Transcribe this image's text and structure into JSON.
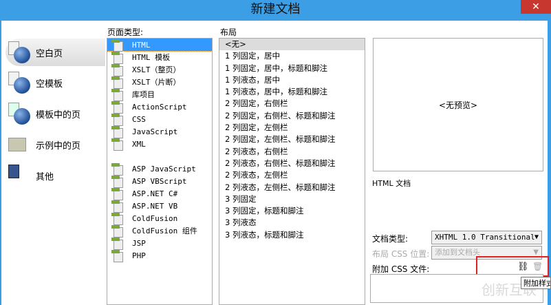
{
  "title": "新建文档",
  "close_label": "✕",
  "categories": [
    {
      "label": "空白页"
    },
    {
      "label": "空模板"
    },
    {
      "label": "模板中的页"
    },
    {
      "label": "示例中的页"
    },
    {
      "label": "其他"
    }
  ],
  "page_type": {
    "label": "页面类型:",
    "items": [
      "HTML",
      "HTML 模板",
      "XSLT（整页）",
      "XSLT（片断）",
      "库项目",
      "ActionScript",
      "CSS",
      "JavaScript",
      "XML",
      "",
      "ASP JavaScript",
      "ASP VBScript",
      "ASP.NET C#",
      "ASP.NET VB",
      "ColdFusion",
      "ColdFusion 组件",
      "JSP",
      "PHP"
    ]
  },
  "layout": {
    "label": "布局",
    "items": [
      "<无>",
      "1 列固定，居中",
      "1 列固定，居中，标题和脚注",
      "1 列液态，居中",
      "1 列液态，居中，标题和脚注",
      "2 列固定，右侧栏",
      "2 列固定，右侧栏、标题和脚注",
      "2 列固定，左侧栏",
      "2 列固定，左侧栏、标题和脚注",
      "2 列液态，右侧栏",
      "2 列液态，右侧栏、标题和脚注",
      "2 列液态，左侧栏",
      "2 列液态，左侧栏、标题和脚注",
      "3 列固定",
      "3 列固定，标题和脚注",
      "3 列液态",
      "3 列液态，标题和脚注"
    ]
  },
  "preview": {
    "text": "<无预览>",
    "description": "HTML 文档"
  },
  "doctype": {
    "label": "文档类型:",
    "value": "XHTML 1.0 Transitional"
  },
  "layout_css": {
    "label": "布局 CSS 位置:",
    "value": "添加到文档头"
  },
  "attach_css": {
    "label": "附加 CSS 文件:",
    "tooltip": "附加样式"
  },
  "watermark": "创新互联"
}
